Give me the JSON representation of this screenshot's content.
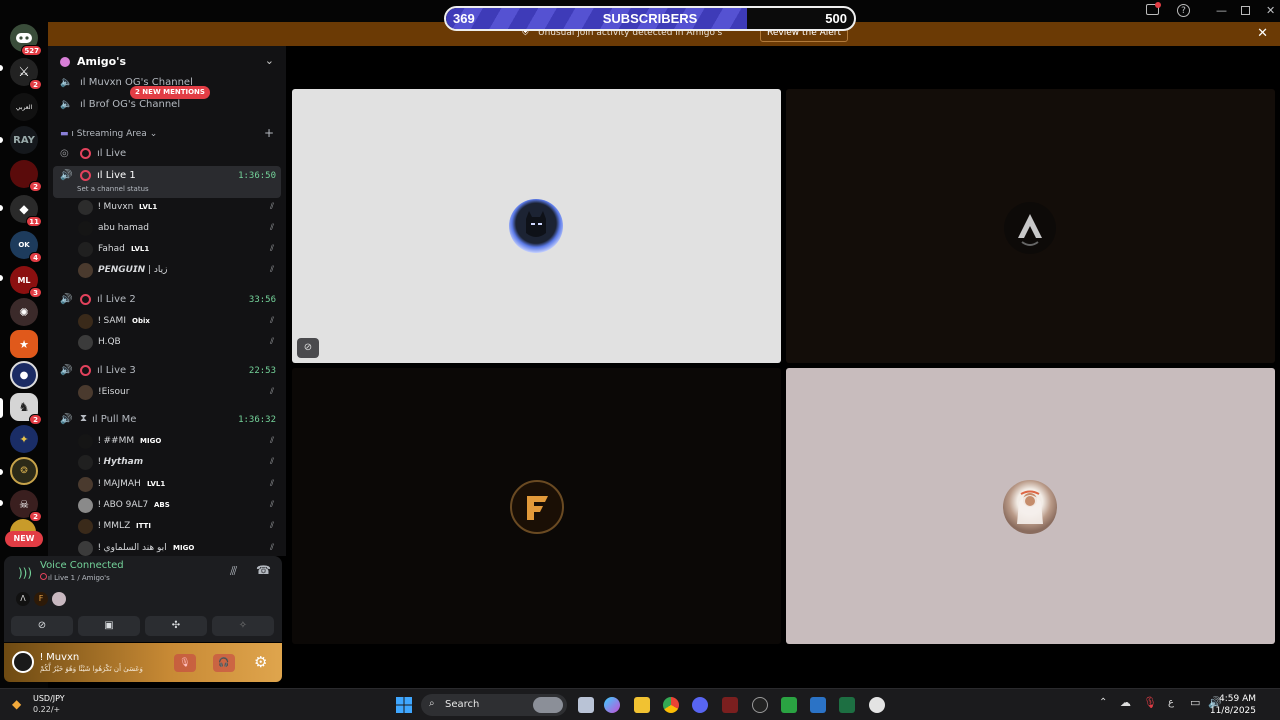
{
  "subscribers": {
    "current": "369",
    "label": "SUBSCRIBERS",
    "goal": "500",
    "progress": 0.738
  },
  "alert": {
    "message": "Unusual join activity detected in Amigo's",
    "button": "Review the Alert"
  },
  "rail": {
    "badges": [
      "527",
      "2",
      "2",
      "11",
      "4",
      "3",
      "2",
      "2"
    ],
    "new_label": "NEW",
    "server_text": [
      "العربي",
      "RAY",
      "OK",
      "ML"
    ]
  },
  "guild": {
    "name": "Amigo's"
  },
  "channels": {
    "muvxn_og": "ıl Muvxn OG's Channel",
    "brof_og": "ıl Brof OG's Channel",
    "mentions": "2 NEW MENTIONS",
    "category": "ı Streaming Area",
    "live": "ıl Live",
    "live1": {
      "name": "ıl Live 1",
      "time": "1:36:50",
      "status": "Set a channel status"
    },
    "live2": {
      "name": "ıl Live 2",
      "time": "33:56"
    },
    "live3": {
      "name": "ıl Live 3",
      "time": "22:53"
    },
    "pullme": {
      "name": "ıl Pull Me",
      "time": "1:36:32"
    }
  },
  "users": {
    "live1": [
      {
        "name": "ǃ Muvxn",
        "tag": "LVL1"
      },
      {
        "name": "abu hamad",
        "tag": ""
      },
      {
        "name": "Fahad",
        "tag": "LVL1"
      },
      {
        "name": "𝙋𝙀𝙉𝙂𝙐𝙄𝙉 | زياد",
        "tag": ""
      }
    ],
    "live2": [
      {
        "name": "ǃ SAMI",
        "tag": "Obix"
      },
      {
        "name": "H.QB",
        "tag": ""
      }
    ],
    "live3": [
      {
        "name": "!Eisour",
        "tag": ""
      }
    ],
    "pullme": [
      {
        "name": "ǃ ##MM",
        "tag": "MIGO"
      },
      {
        "name": "ǃ 𝙃𝙮𝙩𝙝𝙖𝙢",
        "tag": ""
      },
      {
        "name": "ǃ MAJMAH",
        "tag": "LVL1"
      },
      {
        "name": "ǃ ABO 9AL7",
        "tag": "ABS"
      },
      {
        "name": "ǃ MMLZ",
        "tag": "ITTI"
      },
      {
        "name": "ǃ ابو هند السلماوي",
        "tag": "MIGO"
      }
    ]
  },
  "voice": {
    "title": "Voice Connected",
    "channel": "ıl Live 1 / Amigo's"
  },
  "me": {
    "name": "ǃ Muvxn",
    "status": "وَعَسَىٰ أَن تَكْرَهُوا شَيْئًا وَهُوَ خَيْرٌ لَّكُمْ"
  },
  "taskbar": {
    "ticker_name": "USD/JPY",
    "ticker_value": "0.22/+",
    "search": "Search",
    "time": "4:59 AM",
    "date": "11/8/2025",
    "lang": "ع"
  },
  "colors": {
    "accent_green": "#74d39a",
    "alert_bg": "#6b3a05",
    "badge_red": "#e23d45",
    "sub_fill": "#4a47c6"
  }
}
